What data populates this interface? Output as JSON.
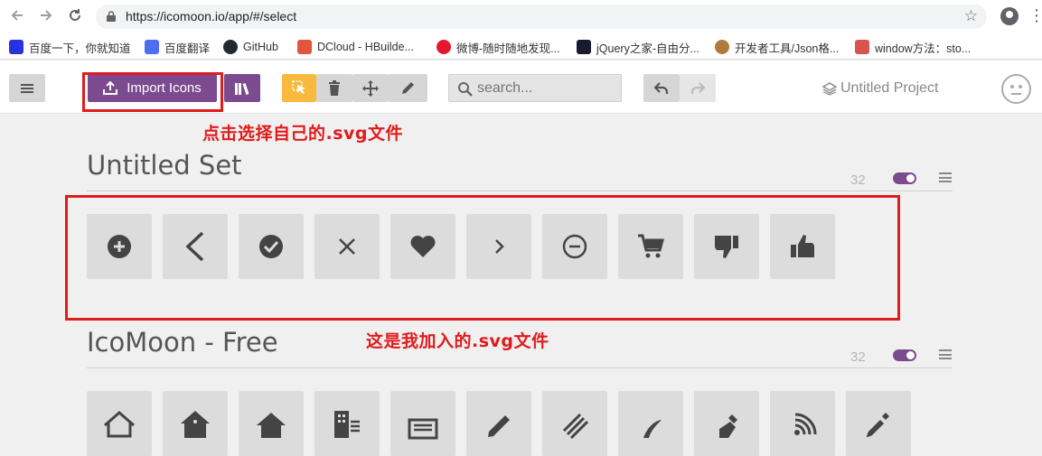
{
  "browser": {
    "url": "https://icomoon.io/app/#/select",
    "bookmarks": [
      {
        "label": "百度一下，你就知道",
        "icon": "baidu-paw-icon",
        "color": "#2932e1"
      },
      {
        "label": "百度翻译",
        "icon": "baidu-translate-icon",
        "color": "#4e6ef2"
      },
      {
        "label": "GitHub",
        "icon": "github-icon",
        "color": "#24292e"
      },
      {
        "label": "DCloud - HBuilde...",
        "icon": "dcloud-icon",
        "color": "#e3543c"
      },
      {
        "label": "微博-随时随地发现...",
        "icon": "weibo-icon",
        "color": "#e6162d"
      },
      {
        "label": "jQuery之家-自由分...",
        "icon": "jquery-icon",
        "color": "#1a1a2e"
      },
      {
        "label": "开发者工具/Json格...",
        "icon": "monkey-icon",
        "color": "#b07a3c"
      },
      {
        "label": "window方法：sto...",
        "icon": "owl-icon",
        "color": "#d9534f"
      }
    ]
  },
  "toolbar": {
    "import_label": "Import Icons",
    "search_placeholder": "search...",
    "project_label": "Untitled Project"
  },
  "annotations": {
    "import_hint": "点击选择自己的.svg文件",
    "added_hint": "这是我加入的.svg文件"
  },
  "sets": [
    {
      "title": "Untitled Set",
      "count": "32",
      "icons": [
        "plus-circle-icon",
        "chevron-left-icon",
        "check-circle-icon",
        "close-icon",
        "heart-icon",
        "chevron-right-icon",
        "minus-circle-icon",
        "cart-icon",
        "thumbs-down-icon",
        "thumbs-up-icon"
      ]
    },
    {
      "title": "IcoMoon - Free",
      "count": "32",
      "icons": [
        "home-icon",
        "home2-icon",
        "home3-icon",
        "office-icon",
        "newspaper-icon",
        "pencil-icon",
        "pencil2-icon",
        "quill-icon",
        "pen-icon",
        "blog-icon",
        "eyedropper-icon"
      ]
    }
  ],
  "colors": {
    "brand_purple": "#7c4a8e",
    "select_yellow": "#f8b93c",
    "annotation_red": "#e01b1b"
  }
}
